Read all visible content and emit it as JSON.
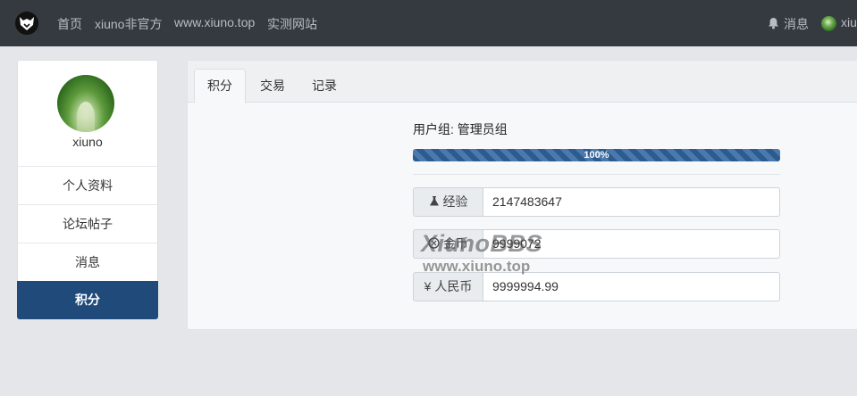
{
  "nav": {
    "links": [
      "首页",
      "xiuno非官方",
      "www.xiuno.top",
      "实测网站"
    ],
    "messages_label": "消息",
    "user_label": "xiu"
  },
  "profile": {
    "username": "xiuno",
    "menu": [
      "个人资料",
      "论坛帖子",
      "消息",
      "积分"
    ],
    "active_menu": "积分"
  },
  "tabs": [
    "积分",
    "交易",
    "记录"
  ],
  "active_tab": "积分",
  "credits": {
    "group_text": "用户组: 管理员组",
    "progress_label": "100%",
    "progress_value": 100,
    "rows": [
      {
        "icon": "flask-icon",
        "label": "经验",
        "value": "2147483647"
      },
      {
        "icon": "coin-icon",
        "label": "金币",
        "value": "9999072"
      },
      {
        "icon": "yen-icon",
        "label": "¥ 人民币",
        "value": "9999994.99"
      }
    ]
  },
  "watermark": {
    "line1": "XiunoBBS",
    "line2": "www.xiuno.top"
  },
  "colors": {
    "nav_bg": "#343a40",
    "active_menu_bg": "#1f4a7a",
    "progress": "#2c5b8f"
  }
}
